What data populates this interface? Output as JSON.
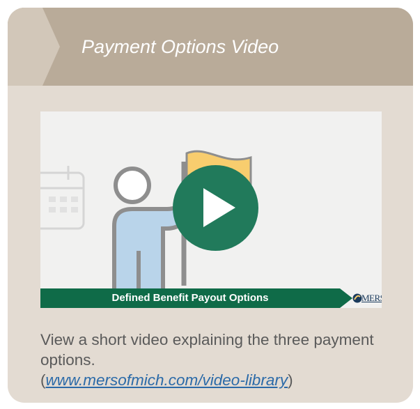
{
  "card": {
    "title": "Payment Options Video",
    "description": "View a short video explaining the three payment options.",
    "link_open": "(",
    "link_text": "www.mersofmich.com/video-library",
    "link_close": ")"
  },
  "video": {
    "caption": "Defined Benefit Payout Options",
    "brand": "MERS",
    "play_icon": "play-icon"
  },
  "colors": {
    "card_background": "#e3dbd2",
    "header_background": "#b9ab99",
    "play_button": "#217a5b",
    "caption_bar": "#0f6b48",
    "link": "#2b6aa8"
  }
}
